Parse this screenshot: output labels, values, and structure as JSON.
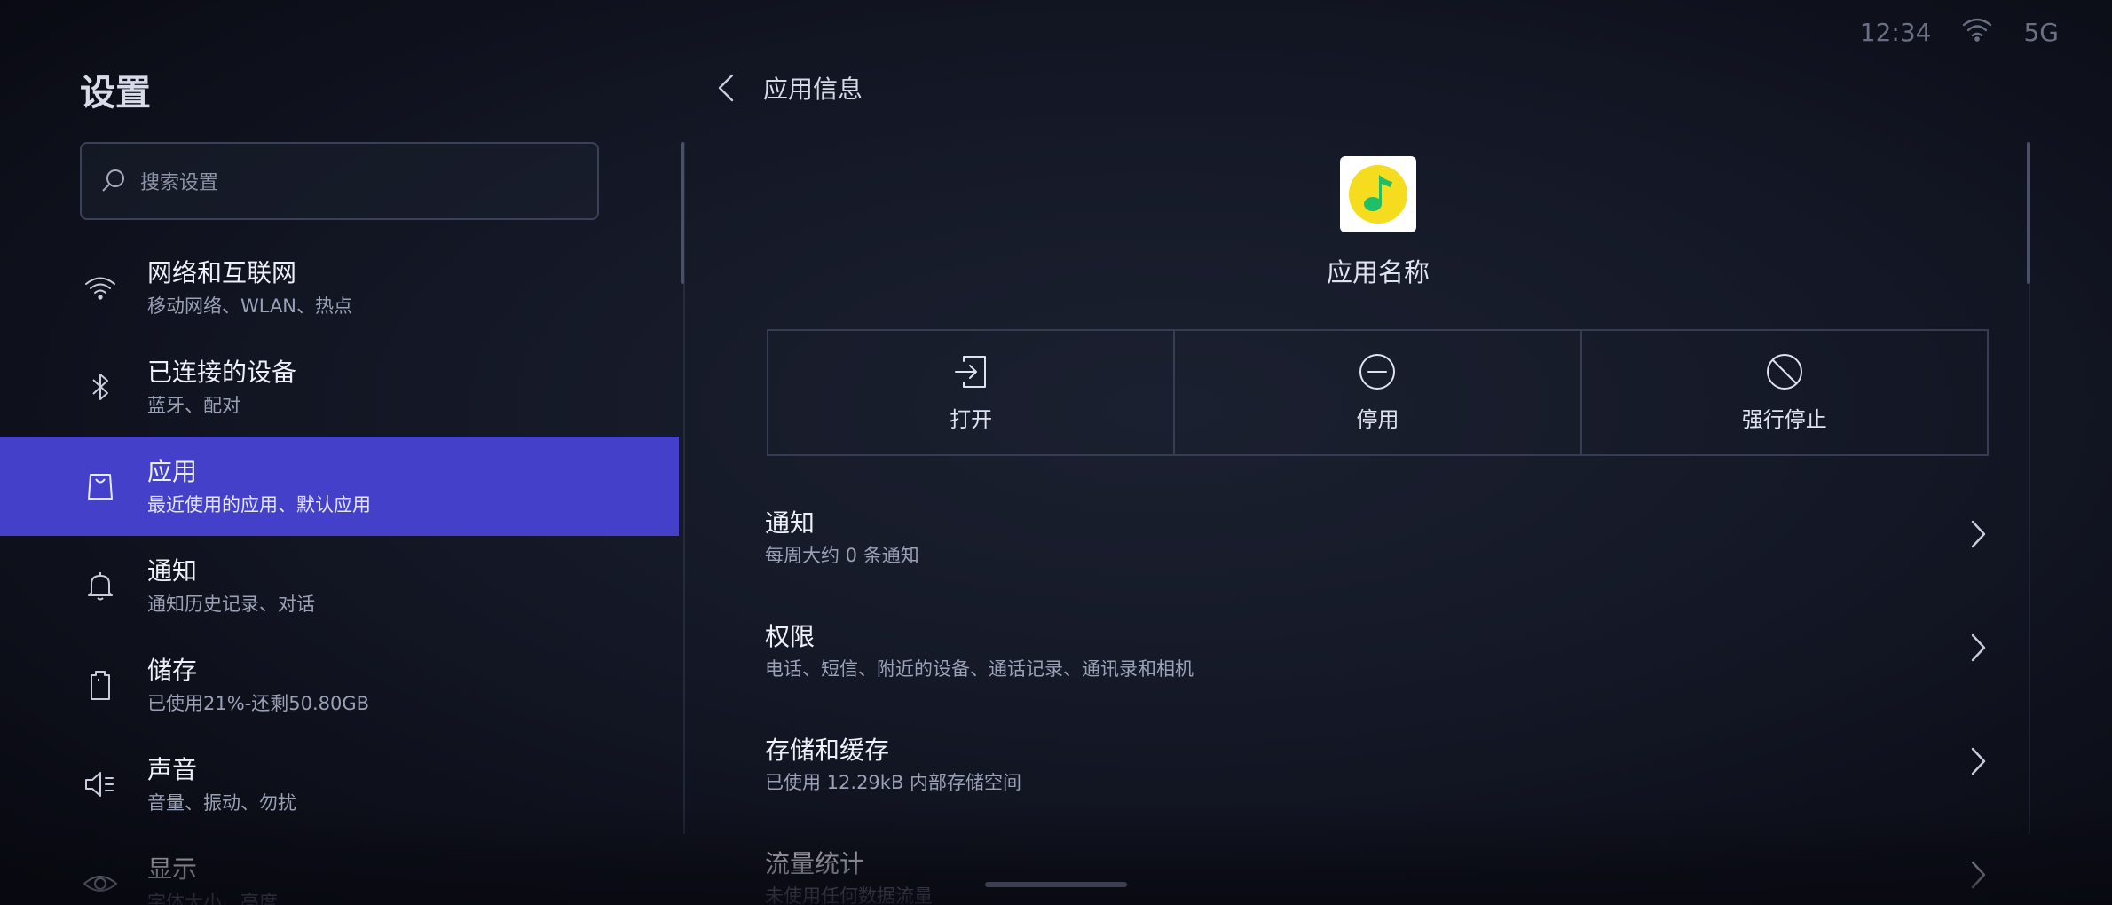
{
  "status_bar": {
    "time": "12:34",
    "network": "5G"
  },
  "left": {
    "title": "设置",
    "search": {
      "placeholder": "搜索设置"
    },
    "items": [
      {
        "title": "网络和互联网",
        "subtitle": "移动网络、WLAN、热点",
        "icon": "wifi-icon",
        "active": false
      },
      {
        "title": "已连接的设备",
        "subtitle": "蓝牙、配对",
        "icon": "bluetooth-icon",
        "active": false
      },
      {
        "title": "应用",
        "subtitle": "最近使用的应用、默认应用",
        "icon": "apps-bag-icon",
        "active": true
      },
      {
        "title": "通知",
        "subtitle": "通知历史记录、对话",
        "icon": "bell-icon",
        "active": false
      },
      {
        "title": "储存",
        "subtitle": "已使用21%-还剩50.80GB",
        "icon": "storage-icon",
        "active": false
      },
      {
        "title": "声音",
        "subtitle": "音量、振动、勿扰",
        "icon": "speaker-icon",
        "active": false
      },
      {
        "title": "显示",
        "subtitle": "字体大小、亮度",
        "icon": "eye-icon",
        "active": false
      }
    ]
  },
  "right": {
    "title": "应用信息",
    "app_name": "应用名称",
    "actions": [
      {
        "label": "打开",
        "icon": "open-icon"
      },
      {
        "label": "停用",
        "icon": "disable-icon"
      },
      {
        "label": "强行停止",
        "icon": "force-stop-icon"
      }
    ],
    "rows": [
      {
        "title": "通知",
        "subtitle": "每周大约 0 条通知"
      },
      {
        "title": "权限",
        "subtitle": "电话、短信、附近的设备、通话记录、通讯录和相机"
      },
      {
        "title": "存储和缓存",
        "subtitle": "已使用 12.29kB 内部存储空间"
      },
      {
        "title": "流量统计",
        "subtitle": "未使用任何数据流量"
      }
    ]
  },
  "colors": {
    "accent": "#4540c9",
    "background": "#141826",
    "app_icon_yellow": "#f5dc1f",
    "app_icon_green": "#1fbf6a"
  }
}
